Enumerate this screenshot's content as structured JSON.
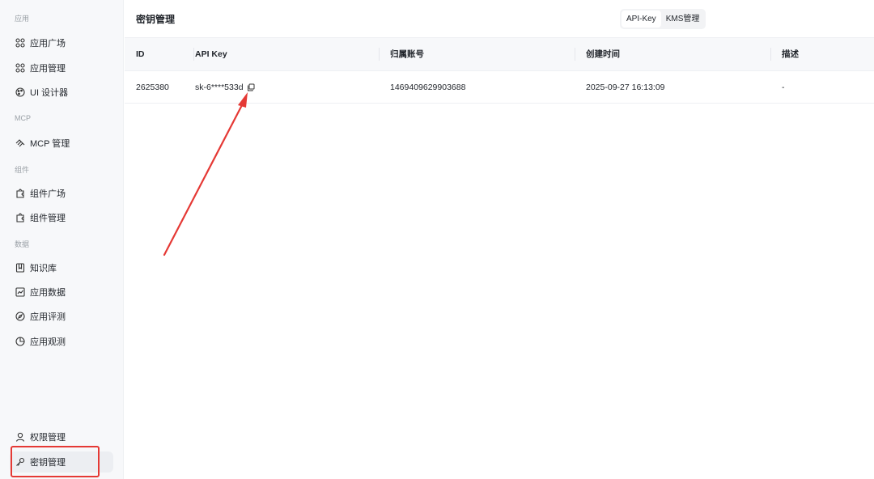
{
  "sidebar": {
    "sections": [
      "应用",
      "MCP",
      "组件",
      "数据"
    ],
    "items": [
      {
        "label": "应用广场",
        "icon": "grid-icon"
      },
      {
        "label": "应用管理",
        "icon": "grid-icon"
      },
      {
        "label": "UI 设计器",
        "icon": "palette-icon"
      },
      {
        "label": "MCP 管理",
        "icon": "mcp-icon"
      },
      {
        "label": "组件广场",
        "icon": "puzzle-icon"
      },
      {
        "label": "组件管理",
        "icon": "puzzle-icon"
      },
      {
        "label": "知识库",
        "icon": "book-icon"
      },
      {
        "label": "应用数据",
        "icon": "line-chart-icon"
      },
      {
        "label": "应用评测",
        "icon": "compass-icon"
      },
      {
        "label": "应用观测",
        "icon": "pie-chart-icon"
      },
      {
        "label": "权限管理",
        "icon": "user-icon"
      },
      {
        "label": "密钥管理",
        "icon": "key-icon",
        "active": true
      }
    ]
  },
  "header": {
    "title": "密钥管理",
    "tabs": [
      "API-Key",
      "KMS管理"
    ],
    "active_tab": "API-Key"
  },
  "table": {
    "columns": [
      "ID",
      "API Key",
      "归属账号",
      "创建时间",
      "描述"
    ],
    "rows": [
      {
        "id": "2625380",
        "api_key": "sk-6****533d",
        "account": "1469409629903688",
        "created": "2025-09-27 16:13:09",
        "description": "-"
      }
    ]
  },
  "colors": {
    "annotation": "#e53935",
    "sidebar_bg": "#f7f8fa",
    "header_bg": "#f7f8fa"
  }
}
